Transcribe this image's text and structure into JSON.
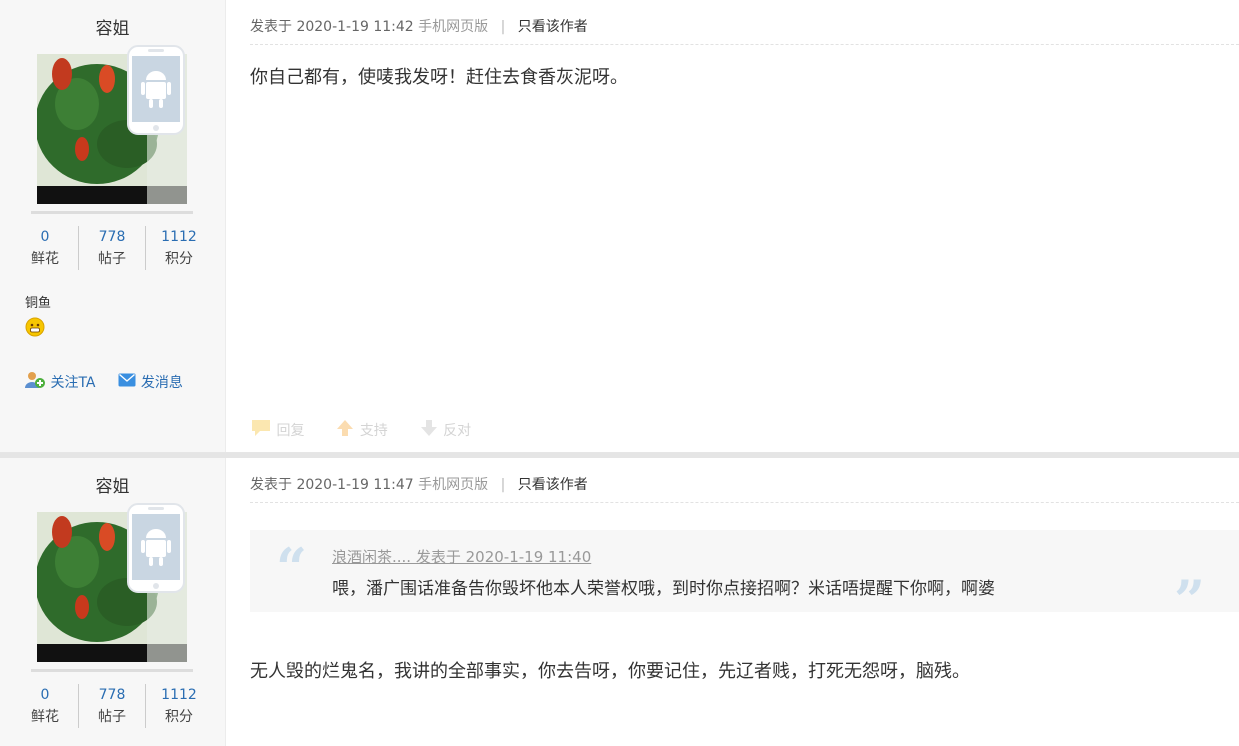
{
  "posts": [
    {
      "username": "容姐",
      "stats": [
        {
          "num": "0",
          "label": "鲜花"
        },
        {
          "num": "778",
          "label": "帖子"
        },
        {
          "num": "1112",
          "label": "积分"
        }
      ],
      "rank": "铜鱼",
      "follow": "关注TA",
      "message": "发消息",
      "meta": {
        "posted": "发表于 2020-1-19 11:42",
        "source": "手机网页版",
        "sep": "|",
        "only_author": "只看该作者"
      },
      "content": "你自己都有，使唛我发呀！赶住去食香灰泥呀。",
      "actions": {
        "reply": "回复",
        "support": "支持",
        "oppose": "反对"
      }
    },
    {
      "username": "容姐",
      "stats": [
        {
          "num": "0",
          "label": "鲜花"
        },
        {
          "num": "778",
          "label": "帖子"
        },
        {
          "num": "1112",
          "label": "积分"
        }
      ],
      "meta": {
        "posted": "发表于 2020-1-19 11:47",
        "source": "手机网页版",
        "sep": "|",
        "only_author": "只看该作者"
      },
      "quote": {
        "header": "浪酒闲茶.... 发表于 2020-1-19 11:40",
        "text": "喂，潘广围话准备告你毁坏他本人荣誉权哦，到时你点接招啊？米话唔提醒下你啊，啊婆",
        "open_mark": "“",
        "close_mark": "”"
      },
      "content": "无人毁的烂鬼名，我讲的全部事实，你去告呀，你要记住，先辽者贱，打死无怨呀，脑残。"
    }
  ],
  "colors": {
    "link": "#2a6db2",
    "quote_mark": "#cfe0ee",
    "sidebar_bg": "#f7f7f7"
  },
  "icons": [
    "android-phone-icon",
    "smile-rank-icon",
    "follow-icon",
    "message-icon",
    "reply-icon",
    "support-icon",
    "oppose-icon"
  ]
}
